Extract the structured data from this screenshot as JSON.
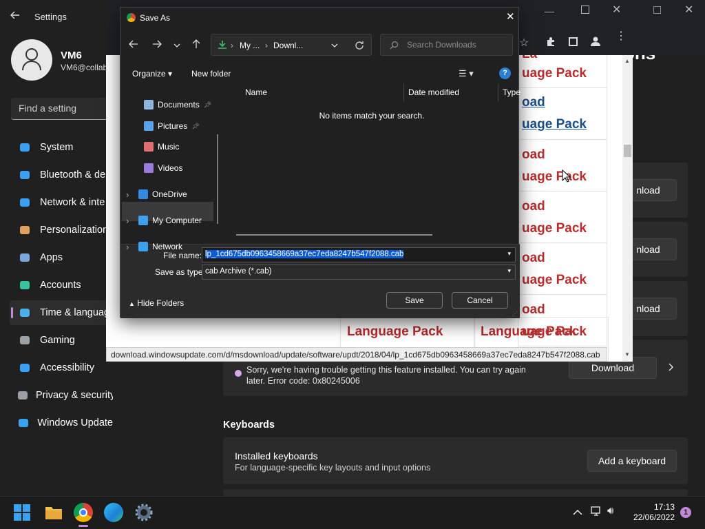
{
  "settings": {
    "title": "Settings",
    "user": {
      "name": "VM6",
      "email": "VM6@collab"
    },
    "search_placeholder": "Find a setting",
    "nav": [
      {
        "label": "System",
        "icon": "monitor-icon"
      },
      {
        "label": "Bluetooth & de",
        "icon": "bluetooth-icon"
      },
      {
        "label": "Network & inte",
        "icon": "wifi-icon"
      },
      {
        "label": "Personalization",
        "icon": "brush-icon"
      },
      {
        "label": "Apps",
        "icon": "apps-icon"
      },
      {
        "label": "Accounts",
        "icon": "person-icon"
      },
      {
        "label": "Time & languag",
        "icon": "clock-globe-icon"
      },
      {
        "label": "Gaming",
        "icon": "gamepad-icon"
      },
      {
        "label": "Accessibility",
        "icon": "accessibility-icon"
      },
      {
        "label": "Privacy & security",
        "icon": "shield-icon"
      },
      {
        "label": "Windows Update",
        "icon": "update-icon"
      }
    ],
    "heading_tail": "ons",
    "download_label": "nload",
    "download_full": "Download",
    "error_text": "Sorry, we're having trouble getting this feature installed. You can try again later. Error code: 0x80245006",
    "keyboards_heading": "Keyboards",
    "installed_keyboards": "Installed keyboards",
    "installed_keyboards_sub": "For language-specific key layouts and input options",
    "add_keyboard": "Add a keyboard"
  },
  "browser": {
    "status_url": "download.windowsupdate.com/d/msdownload/update/software/updt/2018/04/lp_1cd675db0963458669a37ec7eda8247b547f2088.cab",
    "links": {
      "top_partial": "La",
      "row1": "uage Pack",
      "row2a": "oad",
      "row2b": "uage Pack",
      "row3a": "oad",
      "row3b": "uage Pack",
      "row4a": "oad",
      "row4b": "uage Pack",
      "row5a": "oad",
      "row5b": "uage Pack",
      "row6a": "oad",
      "row6b": "uage Pack",
      "bottom1": "Language Pack",
      "bottom2": "Language Pack"
    }
  },
  "dialog": {
    "title": "Save As",
    "breadcrumb": [
      "My ...",
      "Downl..."
    ],
    "search_placeholder": "Search Downloads",
    "organize": "Organize",
    "new_folder": "New folder",
    "tree": [
      {
        "label": "Documents",
        "pinned": true,
        "icon": "documents-icon"
      },
      {
        "label": "Pictures",
        "pinned": true,
        "icon": "pictures-icon"
      },
      {
        "label": "Music",
        "icon": "music-icon"
      },
      {
        "label": "Videos",
        "icon": "videos-icon"
      },
      {
        "label": "OneDrive",
        "icon": "onedrive-icon"
      },
      {
        "label": "My Computer",
        "icon": "computer-icon"
      },
      {
        "label": "Network",
        "icon": "network-icon"
      }
    ],
    "columns": [
      "Name",
      "Date modified",
      "Type"
    ],
    "empty_message": "No items match your search.",
    "file_name_label": "File name:",
    "file_name_value": "lp_1cd675db0963458669a37ec7eda8247b547f2088.cab",
    "save_type_label": "Save as type:",
    "save_type_value": "cab Archive (*.cab)",
    "hide_folders": "Hide Folders",
    "save": "Save",
    "cancel": "Cancel"
  },
  "taskbar": {
    "time": "17:13",
    "date": "22/06/2022",
    "notification_count": "1"
  },
  "colors": {
    "accent": "#0078d4",
    "link_red": "#b82d2d",
    "link_blue": "#1a4f8a",
    "selection": "#0a5bd6"
  }
}
